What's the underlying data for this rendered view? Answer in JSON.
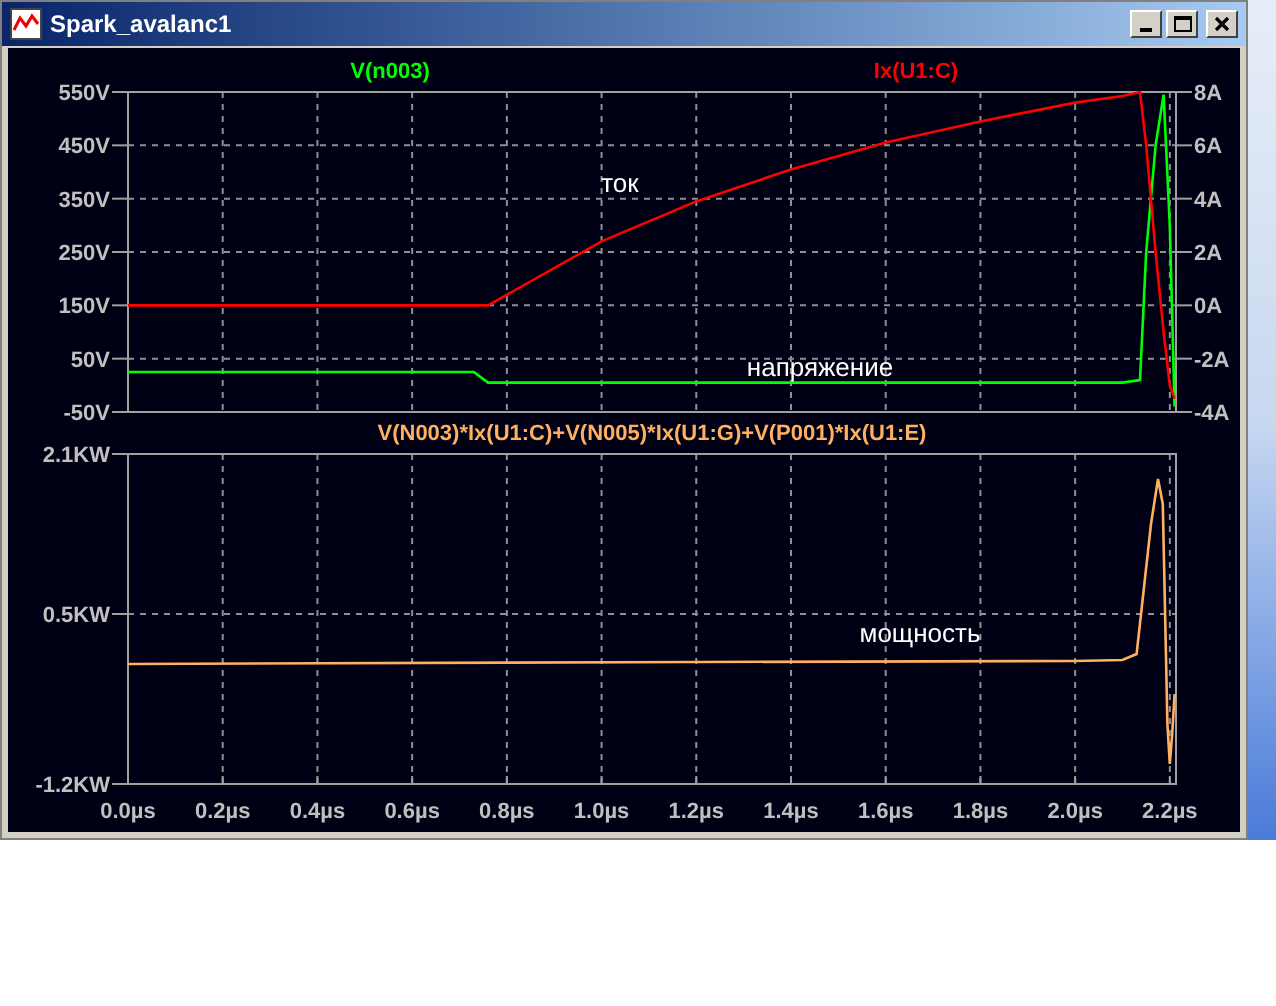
{
  "window": {
    "title": "Spark_avalanc1"
  },
  "voltage_plot": {
    "chart_data": {
      "type": "line",
      "grid": true,
      "x": [
        0,
        0.73,
        0.76,
        1.0,
        1.2,
        1.4,
        1.6,
        1.8,
        2.0,
        2.1,
        2.137,
        2.15,
        2.17,
        2.187,
        2.2,
        2.21
      ],
      "series": [
        {
          "name": "V(n003)",
          "color": "#00ff00",
          "values": [
            25,
            25,
            5,
            5,
            5,
            5,
            5,
            5,
            5,
            5,
            10,
            250,
            450,
            545,
            300,
            -40
          ]
        }
      ],
      "xlim": [
        0,
        2.213
      ],
      "ylim": [
        -50,
        550
      ],
      "yticks": [
        {
          "value": 550,
          "label": "550V"
        },
        {
          "value": 450,
          "label": "450V"
        },
        {
          "value": 350,
          "label": "350V"
        },
        {
          "value": 250,
          "label": "250V"
        },
        {
          "value": 150,
          "label": "150V"
        },
        {
          "value": 50,
          "label": "50V"
        },
        {
          "value": -50,
          "label": "-50V"
        }
      ],
      "annotations": [
        "ток",
        "напряжение"
      ]
    }
  },
  "current_plot": {
    "chart_data": {
      "type": "line",
      "x": [
        0,
        0.73,
        0.76,
        1.0,
        1.2,
        1.4,
        1.6,
        1.8,
        2.0,
        2.1,
        2.137,
        2.15,
        2.17,
        2.187,
        2.2,
        2.21
      ],
      "series": [
        {
          "name": "Ix(U1:C)",
          "color": "#ff0000",
          "values": [
            0,
            0,
            0,
            2.4,
            3.9,
            5.1,
            6.1,
            6.9,
            7.6,
            7.85,
            8,
            6,
            2,
            -1,
            -3,
            -3.5
          ]
        }
      ],
      "xlim": [
        0,
        2.213
      ],
      "ylim": [
        -4,
        8
      ],
      "yticks": [
        {
          "value": 8,
          "label": "8A"
        },
        {
          "value": 6,
          "label": "6A"
        },
        {
          "value": 4,
          "label": "4A"
        },
        {
          "value": 2,
          "label": "2A"
        },
        {
          "value": 0,
          "label": "0A"
        },
        {
          "value": -2,
          "label": "-2A"
        },
        {
          "value": -4,
          "label": "-4A"
        }
      ]
    }
  },
  "power_plot": {
    "chart_data": {
      "type": "line",
      "grid": true,
      "x": [
        0,
        1.2,
        2.0,
        2.1,
        2.13,
        2.16,
        2.175,
        2.185,
        2.195,
        2.2,
        2.205,
        2.21
      ],
      "series": [
        {
          "name": "V(N003)*Ix(U1:C)+V(N005)*Ix(U1:G)+V(P001)*Ix(U1:E)",
          "color": "#ffb060",
          "values": [
            0,
            0.02,
            0.03,
            0.04,
            0.1,
            1.4,
            1.85,
            1.6,
            -0.6,
            -1.0,
            -0.7,
            -0.3
          ]
        }
      ],
      "xlim": [
        0,
        2.213
      ],
      "ylim": [
        -1.2,
        2.1
      ],
      "xticks": [
        {
          "value": 0,
          "label": "0.0µs"
        },
        {
          "value": 0.2,
          "label": "0.2µs"
        },
        {
          "value": 0.4,
          "label": "0.4µs"
        },
        {
          "value": 0.6,
          "label": "0.6µs"
        },
        {
          "value": 0.8,
          "label": "0.8µs"
        },
        {
          "value": 1.0,
          "label": "1.0µs"
        },
        {
          "value": 1.2,
          "label": "1.2µs"
        },
        {
          "value": 1.4,
          "label": "1.4µs"
        },
        {
          "value": 1.6,
          "label": "1.6µs"
        },
        {
          "value": 1.8,
          "label": "1.8µs"
        },
        {
          "value": 2.0,
          "label": "2.0µs"
        },
        {
          "value": 2.2,
          "label": "2.2µs"
        }
      ],
      "yticks": [
        {
          "value": 2.1,
          "label": "2.1KW"
        },
        {
          "value": 0.5,
          "label": "0.5KW"
        },
        {
          "value": -1.2,
          "label": "-1.2KW"
        }
      ],
      "annotations": [
        "мощность"
      ]
    }
  }
}
